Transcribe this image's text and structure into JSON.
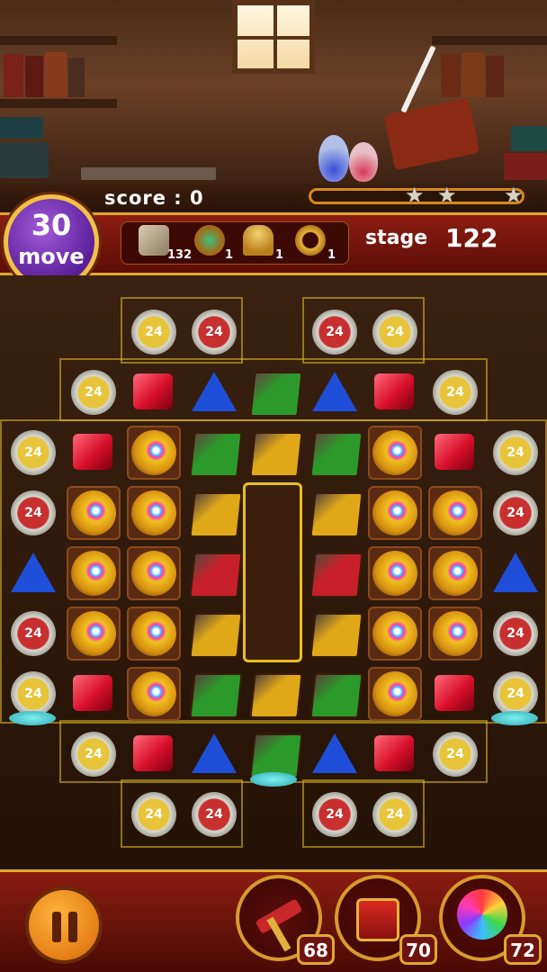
{
  "hud": {
    "score_text": "score : 0",
    "moves": "30",
    "moves_label": "move",
    "stage_label": "stage",
    "stage_number": "122",
    "stars_earned": 0,
    "stars_total": 3
  },
  "goals": [
    {
      "icon": "stone-tablet-icon",
      "count": "132"
    },
    {
      "icon": "jeweled-amulet-icon",
      "count": "1"
    },
    {
      "icon": "golden-chalice-icon",
      "count": "1"
    },
    {
      "icon": "golden-ring-icon",
      "count": "1"
    }
  ],
  "bubble_counter": "24",
  "colors": {
    "red_gem": "#d8102a",
    "blue_gem": "#1f4fd8",
    "green_book": "#2c9a2a",
    "gold_book": "#e0a818",
    "red_book": "#c8202a",
    "gold_bubble": "#e8c43a",
    "red_bubble": "#c83030",
    "panel_red": "#8c1d12",
    "accent_gold": "#e0a830",
    "move_purple": "#6c2aa8"
  },
  "boosters": [
    {
      "name": "hammer",
      "icon": "hammer-icon",
      "count": "68"
    },
    {
      "name": "treasure-chest",
      "icon": "chest-icon",
      "count": "70"
    },
    {
      "name": "rainbow-orb",
      "icon": "rainbow-orb-icon",
      "count": "72"
    }
  ]
}
